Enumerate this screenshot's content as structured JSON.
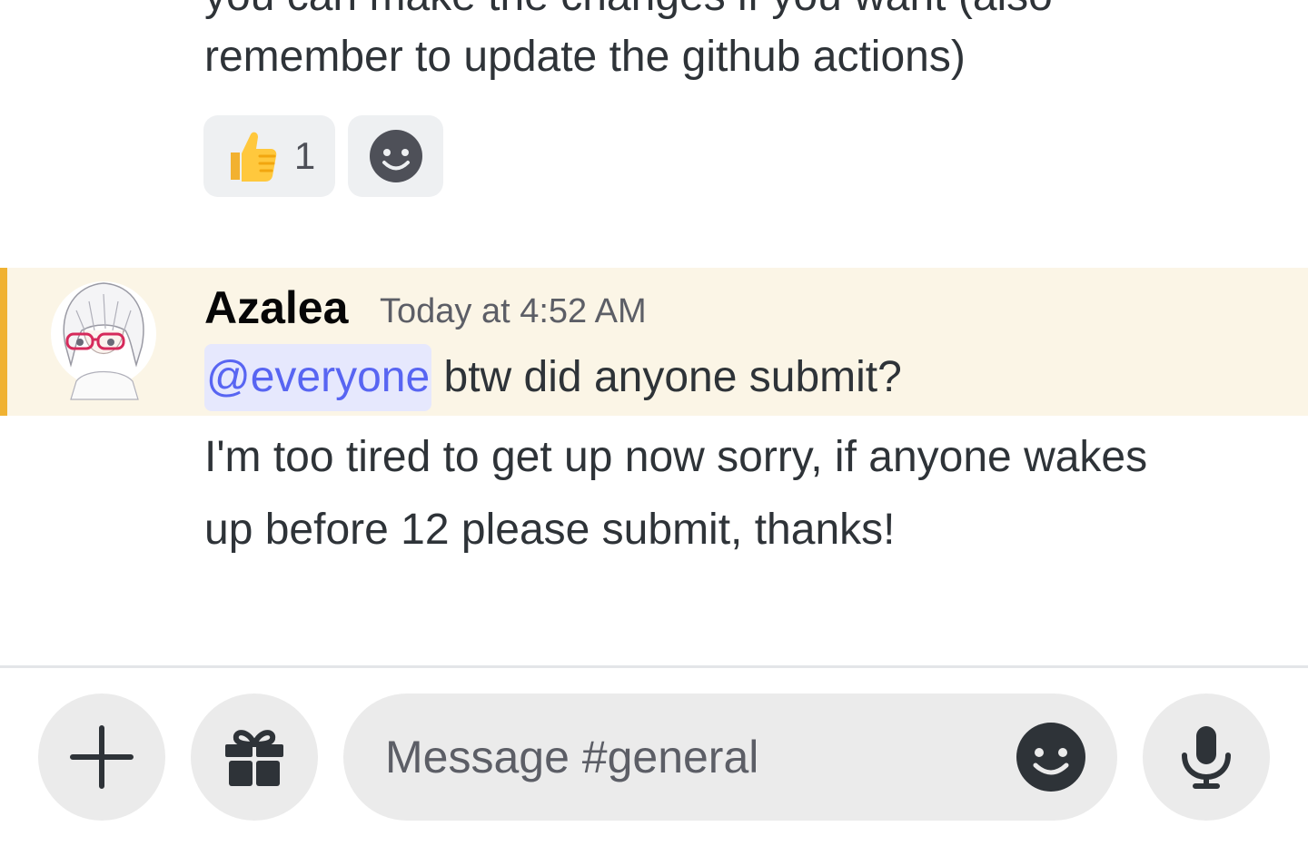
{
  "previous_message": {
    "line1": "you can make the changes if you want (also",
    "line2": "remember to update the github actions)",
    "reactions": [
      {
        "emoji": "thumbs-up",
        "glyph": "👍",
        "count": "1"
      },
      {
        "emoji": "add-reaction"
      }
    ]
  },
  "message": {
    "author": "Azalea",
    "timestamp": "Today at 4:52 AM",
    "mention": "@everyone",
    "line1_rest": " btw did anyone submit?",
    "line2": "I'm too tired to get up now sorry, if anyone wakes",
    "line3": "up before 12 please submit, thanks!",
    "highlight_color": "#fbf5e6",
    "highlight_bar_color": "#f0b232",
    "mention_color": "#5865f2"
  },
  "composer": {
    "placeholder": "Message #general",
    "value": "",
    "buttons": [
      "plus-icon",
      "gift-icon",
      "emoji-icon",
      "microphone-icon"
    ]
  }
}
